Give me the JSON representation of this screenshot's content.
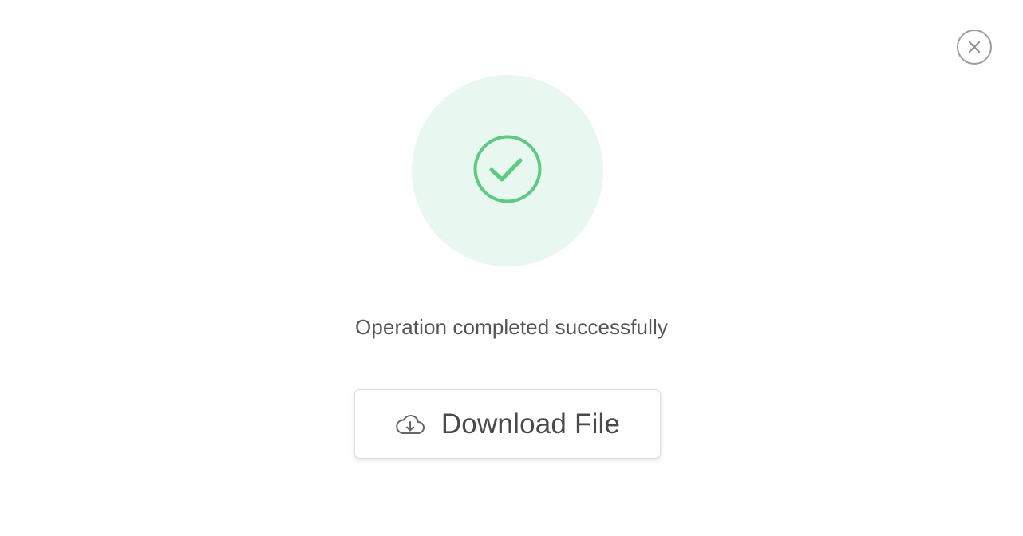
{
  "dialog": {
    "close_icon": "close-icon",
    "success_icon": "check-circle-icon",
    "message": "Operation completed successfully",
    "download_button": {
      "label": "Download File",
      "icon": "cloud-download-icon"
    }
  },
  "colors": {
    "success_green": "#5ccb82",
    "success_halo": "#e8f7ef",
    "close_border": "#9c9c9c",
    "text": "#555555"
  }
}
